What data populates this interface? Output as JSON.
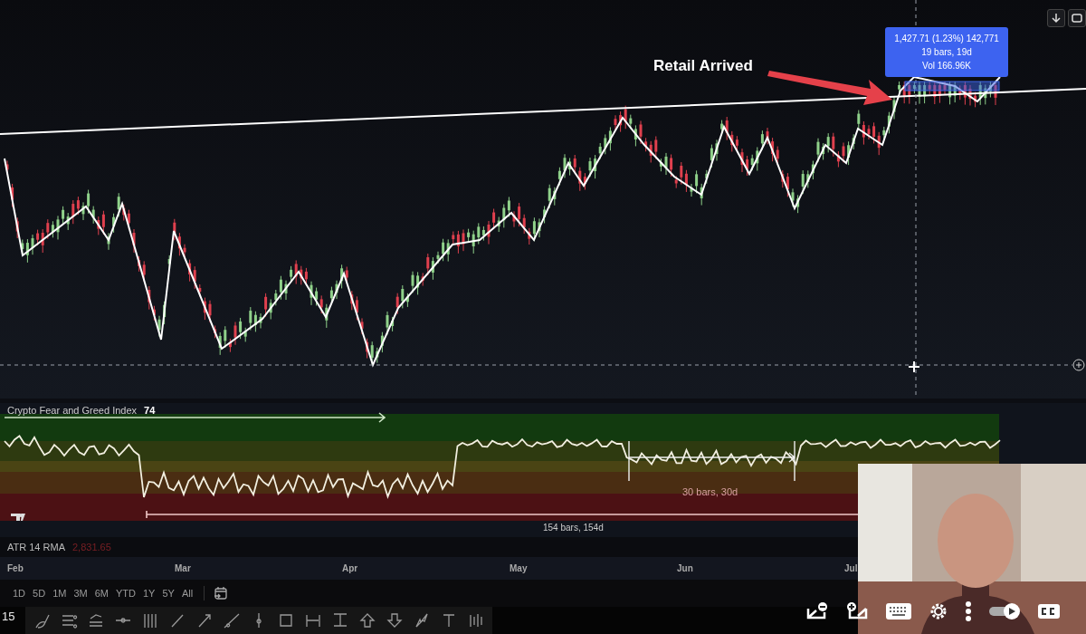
{
  "chart": {
    "annotation": "Retail Arrived",
    "measure_tooltip": [
      "1,427.71 (1.23%) 142,771",
      "19 bars, 19d",
      "Vol 166.96K"
    ]
  },
  "indicator": {
    "title": "Crypto Fear and Greed Index",
    "value": "74",
    "measures": [
      "30 bars, 30d",
      "154 bars, 154d"
    ]
  },
  "atr": {
    "label": "ATR 14 RMA",
    "value": "2,831.65"
  },
  "time_axis": [
    "Feb",
    "Mar",
    "Apr",
    "May",
    "Jun",
    "Jul"
  ],
  "ranges": [
    "1D",
    "5D",
    "1M",
    "3M",
    "6M",
    "YTD",
    "1Y",
    "5Y",
    "All"
  ],
  "toolbar": {
    "interval": "15"
  }
}
